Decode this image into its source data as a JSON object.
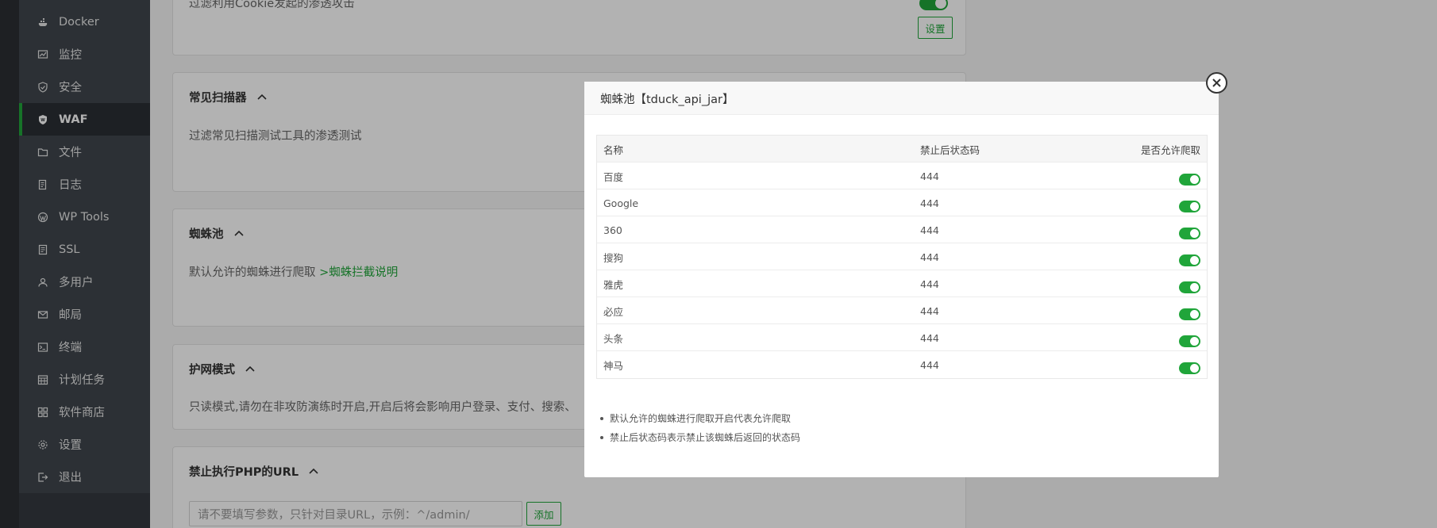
{
  "sidebar": {
    "items": [
      {
        "label": "Docker",
        "icon": "docker-icon"
      },
      {
        "label": "监控",
        "icon": "monitor-icon"
      },
      {
        "label": "安全",
        "icon": "shield-icon"
      },
      {
        "label": "WAF",
        "icon": "waf-icon",
        "active": true
      },
      {
        "label": "文件",
        "icon": "folder-icon"
      },
      {
        "label": "日志",
        "icon": "log-icon"
      },
      {
        "label": "WP Tools",
        "icon": "wordpress-icon"
      },
      {
        "label": "SSL",
        "icon": "ssl-icon"
      },
      {
        "label": "多用户",
        "icon": "users-icon"
      },
      {
        "label": "邮局",
        "icon": "mail-icon"
      },
      {
        "label": "终端",
        "icon": "terminal-icon"
      },
      {
        "label": "计划任务",
        "icon": "calendar-icon"
      },
      {
        "label": "软件商店",
        "icon": "apps-icon"
      },
      {
        "label": "设置",
        "icon": "gear-icon"
      },
      {
        "label": "退出",
        "icon": "logout-icon"
      }
    ]
  },
  "cards": {
    "cookie": {
      "desc": "过滤利用Cookie发起的渗透攻击",
      "settings_label": "设置"
    },
    "scanner": {
      "title": "常见扫描器",
      "desc": "过滤常见扫描测试工具的渗透测试"
    },
    "spider": {
      "title": "蜘蛛池",
      "desc": "默认允许的蜘蛛进行爬取",
      "link": " >蜘蛛拦截说明"
    },
    "protect": {
      "title": "护网模式",
      "desc": "只读模式,请勿在非攻防演练时开启,开启后将会影响用户登录、支付、搜索、"
    },
    "php": {
      "title": "禁止执行PHP的URL",
      "placeholder": "请不要填写参数，只针对目录URL，示例：^/admin/",
      "add_label": "添加"
    }
  },
  "modal": {
    "title": "蜘蛛池【tduck_api_jar】",
    "columns": [
      "名称",
      "禁止后状态码",
      "是否允许爬取"
    ],
    "rows": [
      {
        "name": "百度",
        "code": "444",
        "allowed": true
      },
      {
        "name": "Google",
        "code": "444",
        "allowed": true
      },
      {
        "name": "360",
        "code": "444",
        "allowed": true
      },
      {
        "name": "搜狗",
        "code": "444",
        "allowed": true
      },
      {
        "name": "雅虎",
        "code": "444",
        "allowed": true
      },
      {
        "name": "必应",
        "code": "444",
        "allowed": true
      },
      {
        "name": "头条",
        "code": "444",
        "allowed": true
      },
      {
        "name": "神马",
        "code": "444",
        "allowed": true
      }
    ],
    "notes": [
      "默认允许的蜘蛛进行爬取开启代表允许爬取",
      "禁止后状态码表示禁止该蜘蛛后返回的状态码"
    ]
  },
  "colors": {
    "accent": "#20a53a",
    "sidebar_bg": "#3f464d",
    "sidebar_active": "#2a2f34"
  }
}
